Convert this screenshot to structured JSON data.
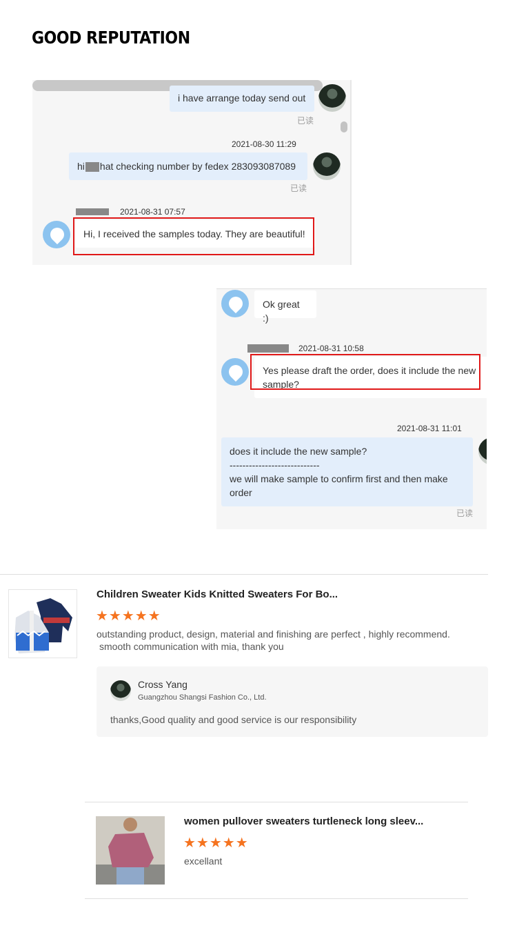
{
  "title": "GOOD REPUTATION",
  "chat1": {
    "msg1": "i have arrange today send out",
    "msg1_read": "已读",
    "ts2": "2021-08-30 11:29",
    "msg2_pre": "hi",
    "msg2_post": "hat checking number by fedex 283093087089",
    "msg2_read": "已读",
    "ts3": "2021-08-31 07:57",
    "msg3": "Hi, I received the samples today. They are beautiful!"
  },
  "chat2": {
    "msg1": "Ok great :)",
    "ts2": "2021-08-31 10:58",
    "msg2": "Yes please draft the order, does it include the new sample?",
    "ts3": "2021-08-31 11:01",
    "msg3_line1": "does it include the new sample?",
    "msg3_line2": "----------------------------",
    "msg3_line3": "we will make sample to confirm first and then make order",
    "msg3_read": "已读"
  },
  "review1": {
    "product": "Children Sweater Kids Knitted Sweaters For Bo...",
    "stars": "★★★★★",
    "rating": 5,
    "text_line1": "outstanding product, design, material and finishing are perfect , highly recommend.",
    "text_line2": "smooth communication with mia, thank you",
    "reply_name": "Cross Yang",
    "reply_company": "Guangzhou Shangsi Fashion Co., Ltd.",
    "reply_text": "thanks,Good quality and good service is our responsibility"
  },
  "review2": {
    "product": "women pullover sweaters turtleneck long sleev...",
    "stars": "★★★★★",
    "rating": 5,
    "text": "excellant"
  },
  "colors": {
    "star": "#f5731f",
    "highlight": "#e01818",
    "outgoing_bubble": "#e3eefb"
  }
}
